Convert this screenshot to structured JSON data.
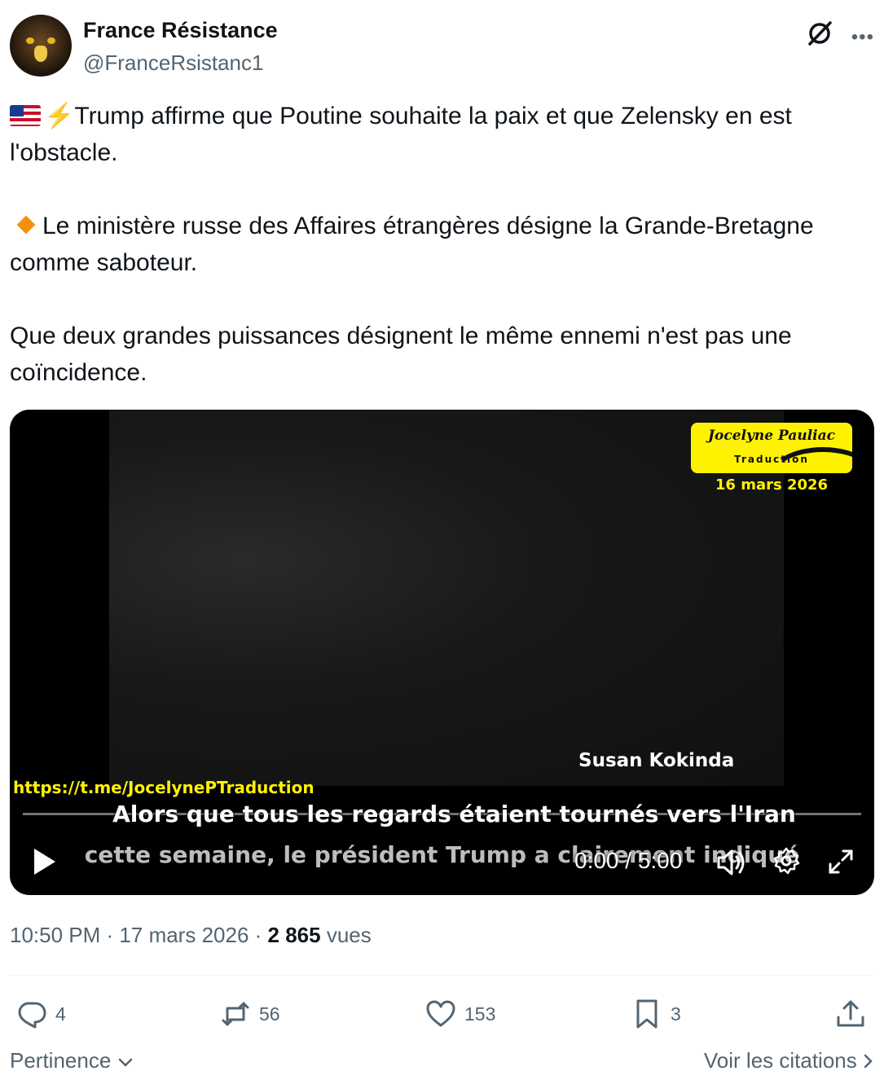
{
  "author": {
    "name": "France Résistance",
    "handle": "@FranceRsistanc1"
  },
  "tweet": {
    "line1": "Trump affirme que Poutine souhaite la paix et que Zelensky en est l'obstacle.",
    "line2": "Le ministère russe des Affaires étrangères désigne la Grande-Bretagne comme saboteur.",
    "line3": "Que deux grandes puissances désignent le même ennemi n'est pas une coïncidence."
  },
  "video": {
    "logo_name": "Jocelyne Pauliac",
    "logo_sub": "Traduction",
    "logo_date": "16 mars 2026",
    "speaker": "Susan Kokinda",
    "link": "https://t.me/JocelynePTraduction",
    "subtitle1": "Alors que tous les regards étaient tournés vers l'Iran",
    "subtitle2": "cette semaine, le président Trump a clairement indiqué",
    "time": "0:00 / 5:00",
    "progress": 0
  },
  "meta": {
    "time": "10:50 PM",
    "date": "17 mars 2026",
    "views_count": "2 865",
    "views_label": "vues"
  },
  "actions": {
    "replies": "4",
    "reposts": "56",
    "likes": "153",
    "bookmarks": "3"
  },
  "footer": {
    "sort_label": "Pertinence",
    "quotes_label": "Voir les citations"
  },
  "colors": {
    "text": "#0f1419",
    "secondary": "#536471",
    "accent": "#1d9bf0",
    "logo_yellow": "#fff200"
  },
  "icons": [
    "grok-icon",
    "more-icon",
    "play-icon",
    "volume-icon",
    "settings-icon",
    "fullscreen-icon",
    "reply-icon",
    "repost-icon",
    "like-icon",
    "bookmark-icon",
    "share-icon",
    "chevron-down-icon",
    "chevron-right-icon"
  ]
}
